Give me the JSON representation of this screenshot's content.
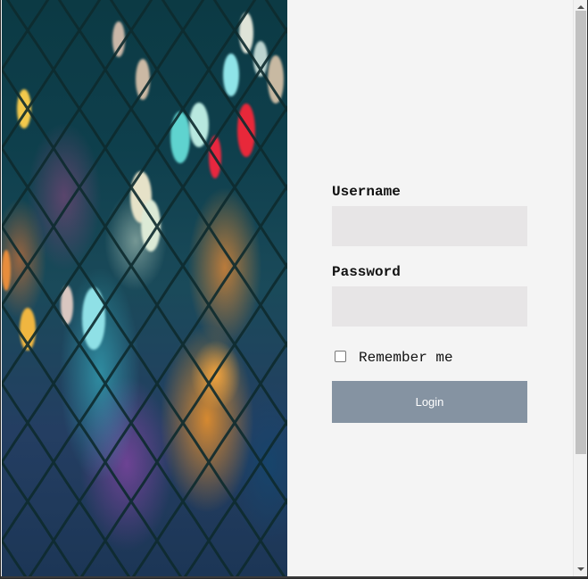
{
  "form": {
    "username_label": "Username",
    "username_value": "",
    "password_label": "Password",
    "password_value": "",
    "remember_label": "Remember me",
    "remember_checked": false,
    "login_label": "Login"
  },
  "colors": {
    "panel_background": "#f4f4f4",
    "input_background": "#e7e5e6",
    "button_background": "#8593a2",
    "button_text": "#ffffff"
  },
  "decor": {
    "photo": "blurred city lights behind a chain-link fence"
  }
}
